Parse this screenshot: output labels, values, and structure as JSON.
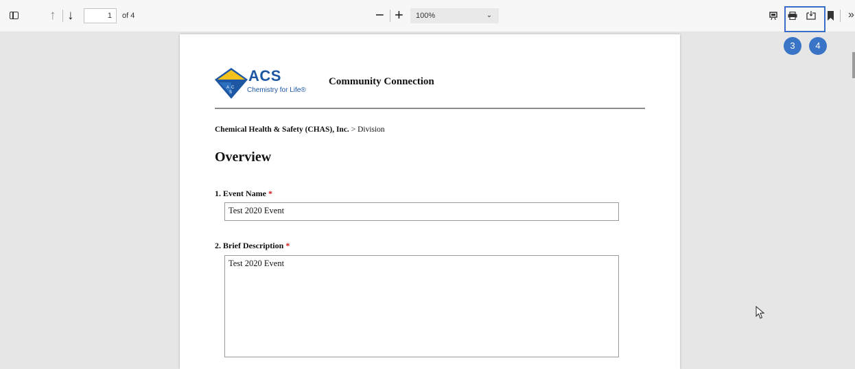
{
  "toolbar": {
    "page_current": "1",
    "page_total_text": "of 4",
    "zoom_minus": "−",
    "zoom_plus": "+",
    "zoom_level": "100%"
  },
  "annotations": {
    "badge_3": "3",
    "badge_4": "4",
    "highlight_color": "#3a6cc9",
    "badge_color": "#3a74c6"
  },
  "document": {
    "logo": {
      "name": "ACS",
      "tagline": "Chemistry for Life®"
    },
    "title": "Community Connection",
    "breadcrumb": {
      "org": "Chemical Health & Safety (CHAS), Inc.",
      "separator": " > ",
      "level": "Division"
    },
    "section_title": "Overview",
    "fields": [
      {
        "label": "1. Event Name",
        "required_mark": "*",
        "value": "Test 2020 Event"
      },
      {
        "label": "2. Brief Description",
        "required_mark": "*",
        "value": "Test 2020 Event"
      }
    ]
  }
}
